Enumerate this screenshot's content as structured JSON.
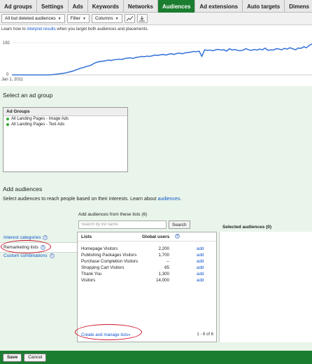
{
  "tabs": [
    {
      "label": "Ad groups"
    },
    {
      "label": "Settings"
    },
    {
      "label": "Ads"
    },
    {
      "label": "Keywords"
    },
    {
      "label": "Networks"
    },
    {
      "label": "Audiences"
    },
    {
      "label": "Ad extensions"
    },
    {
      "label": "Auto targets"
    },
    {
      "label": "Dimens"
    }
  ],
  "active_tab": "Audiences",
  "toolbar": {
    "filter_all": "All but deleted audiences",
    "filter": "Filter",
    "columns": "Columns",
    "chart_icon": "line-chart-icon",
    "download_icon": "download-icon"
  },
  "learn": {
    "prefix": "Learn how to",
    "link": "interpret results",
    "suffix": "when you target both audiences and placements."
  },
  "chart_data": {
    "type": "line",
    "ytick_top": "192",
    "ytick_bottom": "0",
    "x_start_label": "Jan 1, 2011",
    "ylim": [
      0,
      192
    ],
    "x": [
      0,
      4,
      8,
      12,
      16,
      20,
      24,
      28,
      32,
      36,
      40,
      44,
      48,
      52,
      56,
      60,
      64,
      68,
      72,
      76,
      80,
      84,
      88,
      92,
      96,
      100,
      104,
      108,
      112,
      116,
      120,
      124,
      128,
      132,
      136,
      140,
      144,
      148,
      152,
      156,
      160,
      164,
      168,
      172,
      176,
      180,
      184,
      188,
      192,
      196,
      200,
      204,
      208,
      212,
      216,
      220,
      224,
      228,
      232,
      236,
      240,
      244,
      248,
      252,
      256,
      260,
      264,
      268,
      272,
      276,
      280,
      284,
      288,
      292,
      296,
      300,
      304,
      308,
      312,
      316,
      320,
      324,
      328,
      332,
      336,
      340,
      344,
      348,
      352,
      356,
      360,
      364,
      368,
      372,
      376,
      380,
      384,
      388,
      392,
      396,
      400,
      404,
      408,
      412,
      416,
      420,
      424,
      428,
      432,
      436
    ],
    "values": [
      0,
      0,
      0,
      0,
      0,
      0,
      0,
      0,
      0,
      0,
      0,
      0,
      0,
      0,
      1,
      2,
      4,
      6,
      8,
      10,
      14,
      18,
      22,
      28,
      34,
      40,
      44,
      50,
      54,
      60,
      70,
      76,
      80,
      82,
      84,
      88,
      86,
      90,
      92,
      94,
      92,
      98,
      100,
      102,
      98,
      104,
      106,
      110,
      108,
      112,
      110,
      114,
      118,
      116,
      120,
      122,
      118,
      124,
      126,
      122,
      128,
      130,
      126,
      132,
      134,
      136,
      140,
      138,
      142,
      110,
      150,
      146,
      148,
      144,
      150,
      152,
      148,
      150,
      142,
      156,
      148,
      152,
      146,
      144,
      148,
      156,
      150,
      146,
      152,
      148,
      154,
      150,
      160,
      146,
      150,
      148,
      156,
      154,
      150,
      158,
      154,
      162,
      156,
      150,
      160,
      158,
      168,
      162,
      176,
      184
    ],
    "color": "#3c78d8",
    "grid": false
  },
  "adgroup": {
    "heading": "Select an ad group",
    "header": "Ad Groups",
    "items": [
      "All Landing Pages - Image Ads",
      "All Landing Pages - Text Ads"
    ]
  },
  "audiences": {
    "heading": "Add audiences",
    "desc_prefix": "Select audiences to reach people based on their interests. Learn about",
    "desc_link": "audiences",
    "desc_suffix": ".",
    "interest_categories": "Interest categories",
    "remarketing_lists": "Remarketing lists",
    "custom_combinations": "Custom combinations",
    "add_from_label": "Add audiences from these lists (6)",
    "search_placeholder": "Search by list name",
    "search_button": "Search",
    "col_lists": "Lists",
    "col_users": "Global users",
    "rows": [
      {
        "name": "Homepage Visitors",
        "users": "2,200",
        "action": "add"
      },
      {
        "name": "Publishing Packages Visitors",
        "users": "1,700",
        "action": "add"
      },
      {
        "name": "Purchase Completion Visitors",
        "users": "--",
        "action": "add"
      },
      {
        "name": "Shopping Cart Visitors",
        "users": "65",
        "action": "add"
      },
      {
        "name": "Thank You",
        "users": "1,300",
        "action": "add"
      },
      {
        "name": "Visitors",
        "users": "14,000",
        "action": "add"
      }
    ],
    "create_link": "Create and manage lists»",
    "pager": "1 - 6 of 6",
    "selected_header": "Selected audiences (0)",
    "help_glyph": "?"
  },
  "footer": {
    "save": "Save",
    "cancel": "Cancel"
  }
}
